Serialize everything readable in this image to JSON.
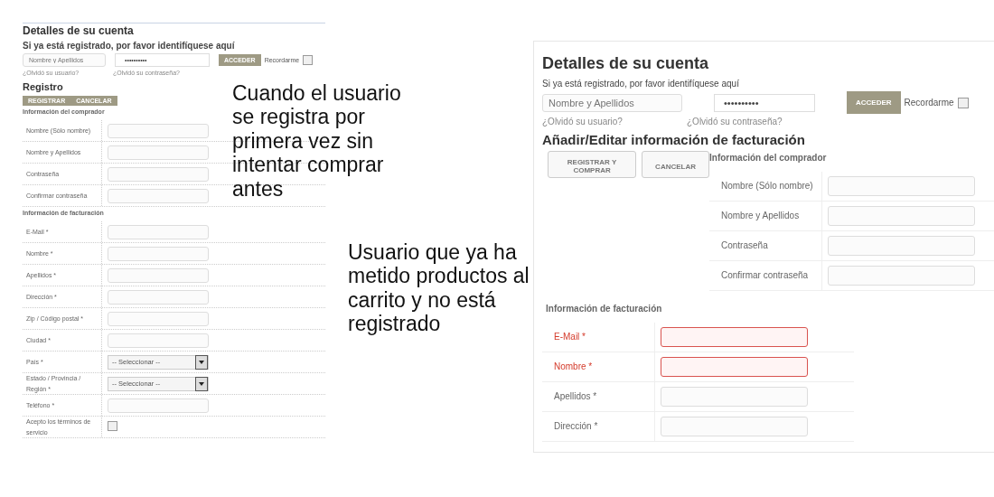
{
  "left_form": {
    "title": "Detalles de su cuenta",
    "login": {
      "heading": "Si ya está registrado, por favor identifíquese aquí",
      "user_placeholder": "Nombre y Apellidos",
      "password_value": "••••••••••",
      "login_button": "ACCEDER",
      "remember_label": "Recordarme",
      "remember_checked": false,
      "forgot_user": "¿Olvidó su usuario?",
      "forgot_password": "¿Olvidó su contraseña?"
    },
    "heading": "Registro",
    "buttons": [
      "REGISTRAR",
      "CANCELAR"
    ],
    "sections": [
      {
        "heading": "Información del comprador",
        "rows": [
          {
            "label": "Nombre (Sólo nombre)",
            "kind": "text",
            "error": false
          },
          {
            "label": "Nombre y Apellidos",
            "kind": "text",
            "error": false
          },
          {
            "label": "Contraseña",
            "kind": "text",
            "error": false
          },
          {
            "label": "Confirmar contraseña",
            "kind": "text",
            "error": false
          }
        ]
      },
      {
        "heading": "Información de facturación",
        "rows": [
          {
            "label": "E-Mail *",
            "kind": "text",
            "error": false
          },
          {
            "label": "Nombre *",
            "kind": "text",
            "error": false
          },
          {
            "label": "Apellidos *",
            "kind": "text",
            "error": false
          },
          {
            "label": "Dirección *",
            "kind": "text",
            "error": false
          },
          {
            "label": "Zip / Código postal *",
            "kind": "text",
            "error": false
          },
          {
            "label": "Ciudad *",
            "kind": "text",
            "error": false
          },
          {
            "label": "País *",
            "kind": "select",
            "value": "-- Seleccionar --",
            "error": false
          },
          {
            "label": "Estado / Provincia / Región *",
            "kind": "select",
            "value": "-- Seleccionar --",
            "error": false
          },
          {
            "label": "Teléfono *",
            "kind": "text",
            "error": false
          },
          {
            "label": "Acepto los términos de servicio",
            "kind": "checkbox",
            "checked": false,
            "error": false
          }
        ]
      }
    ]
  },
  "right_form": {
    "title": "Detalles de su cuenta",
    "login": {
      "heading": "Si ya está registrado, por favor identifíquese aquí",
      "user_placeholder": "Nombre y Apellidos",
      "password_value": "••••••••••",
      "login_button": "ACCEDER",
      "remember_label": "Recordarme",
      "remember_checked": false,
      "forgot_user": "¿Olvidó su usuario?",
      "forgot_password": "¿Olvidó su contraseña?"
    },
    "heading": "Añadir/Editar información de facturación",
    "buttons": [
      "REGISTRAR Y COMPRAR",
      "CANCELAR"
    ],
    "sections": [
      {
        "heading": "Información del comprador",
        "rows": [
          {
            "label": "Nombre (Sólo nombre)",
            "kind": "text",
            "error": false
          },
          {
            "label": "Nombre y Apellidos",
            "kind": "text",
            "error": false
          },
          {
            "label": "Contraseña",
            "kind": "text",
            "error": false
          },
          {
            "label": "Confirmar contraseña",
            "kind": "text",
            "error": false
          }
        ]
      },
      {
        "heading": "Información de facturación",
        "rows": [
          {
            "label": "E-Mail *",
            "kind": "text",
            "error": true
          },
          {
            "label": "Nombre *",
            "kind": "text",
            "error": true
          },
          {
            "label": "Apellidos *",
            "kind": "text",
            "error": false
          },
          {
            "label": "Dirección *",
            "kind": "text",
            "error": false
          }
        ]
      }
    ]
  },
  "captions": [
    "Cuando el usuario se registra por primera vez sin intentar comprar antes",
    "Usuario que ya ha metido productos al carrito y no está registrado"
  ]
}
